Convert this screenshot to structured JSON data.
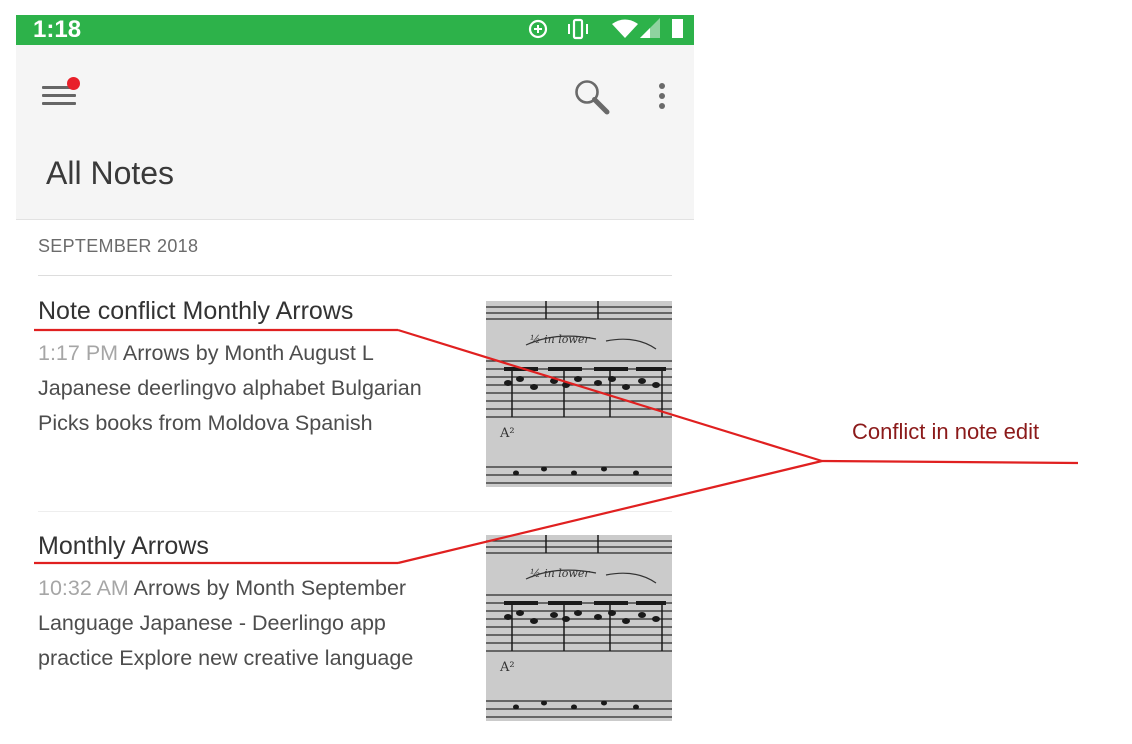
{
  "status_bar": {
    "time": "1:18",
    "color": "#2db24a",
    "icons": [
      "data-saver-icon",
      "vibrate-icon",
      "wifi-icon",
      "signal-icon",
      "battery-icon"
    ]
  },
  "toolbar": {
    "menu_icon": "hamburger-menu-icon",
    "notification_dot_color": "#e8202a",
    "search_icon": "search-icon",
    "more_icon": "more-vert-icon",
    "title": "All Notes"
  },
  "notes_list": {
    "section_header": "SEPTEMBER 2018",
    "notes": [
      {
        "title": "Note conflict Monthly Arrows",
        "time": "1:17 PM",
        "snippet_lines": [
          "Arrows by Month  August  L",
          "Japanese  deerlingvo alphabet Bulgarian",
          "Picks books from Moldova  Spanish"
        ],
        "thumbnail": "sheet-music-thumbnail"
      },
      {
        "title": "Monthly Arrows",
        "time": "10:32 AM",
        "snippet_lines": [
          "Arrows by Month  September",
          "Language Japanese - Deerlingo app",
          "practice  Explore new creative language"
        ],
        "thumbnail": "sheet-music-thumbnail"
      }
    ]
  },
  "annotation": {
    "label": "Conflict in note edit",
    "color": "#e02020",
    "text_color": "#8b1a1a"
  }
}
